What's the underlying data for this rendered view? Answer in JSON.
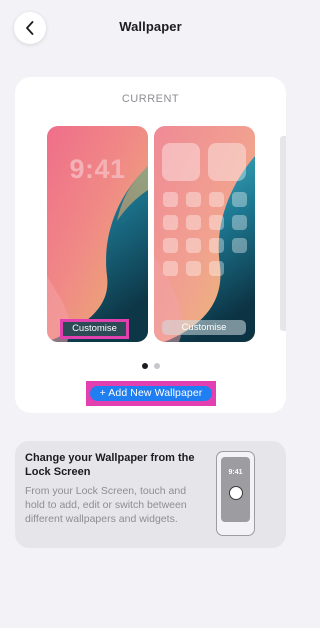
{
  "header": {
    "title": "Wallpaper",
    "back_icon": "chevron-left-icon"
  },
  "current_card": {
    "label": "CURRENT",
    "lock_screen": {
      "time": "9:41",
      "customise_label": "Customise"
    },
    "home_screen": {
      "customise_label": "Customise"
    },
    "page_dots": {
      "count": 2,
      "active_index": 0
    },
    "add_button_label": "+ Add New Wallpaper"
  },
  "tip": {
    "title": "Change your Wallpaper from the Lock Screen",
    "body": "From your Lock Screen, touch and hold to add, edit or switch between different wallpapers and widgets.",
    "illustration_time": "9:41"
  },
  "colors": {
    "accent_blue": "#1f7ef2",
    "highlight_pink": "#e23fb0",
    "background": "#f2f2f7"
  }
}
